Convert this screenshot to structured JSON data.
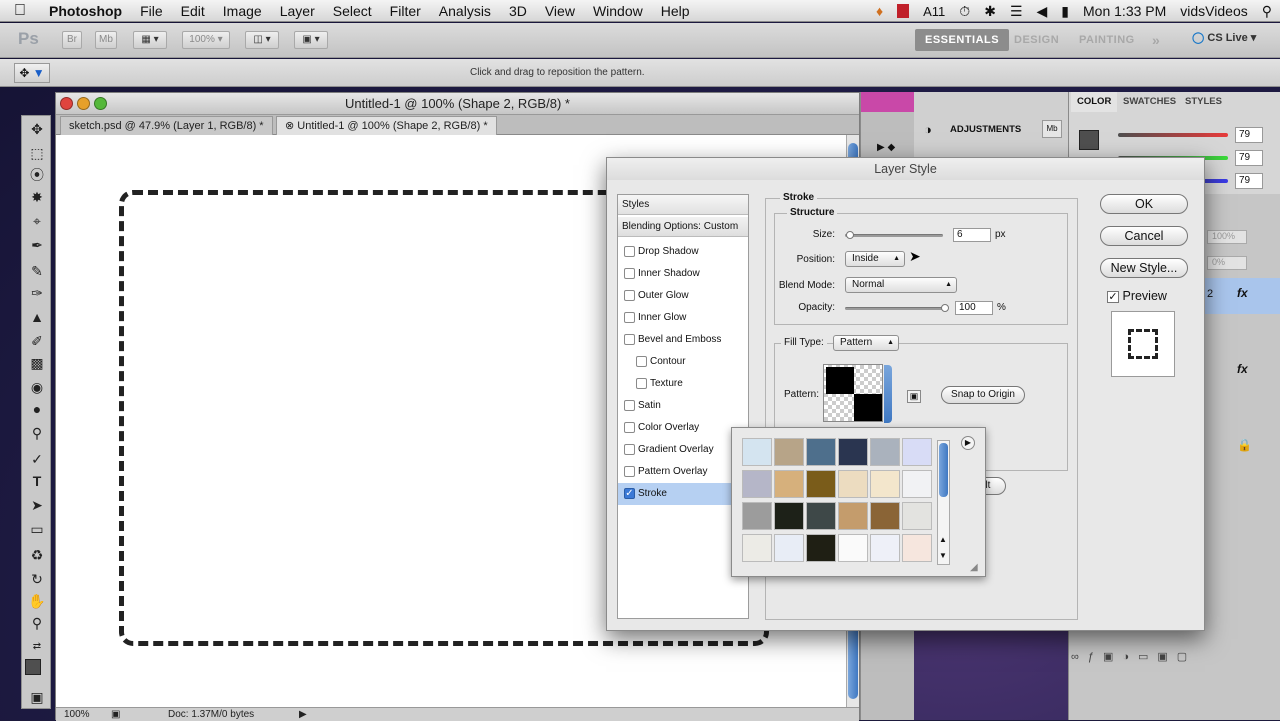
{
  "menubar": {
    "app": "Photoshop",
    "items": [
      "File",
      "Edit",
      "Image",
      "Layer",
      "Select",
      "Filter",
      "Analysis",
      "3D",
      "View",
      "Window",
      "Help"
    ],
    "status_num": "11",
    "clock": "Mon 1:33 PM",
    "user": "vidsVideos"
  },
  "appbar": {
    "logo": "Ps",
    "zoom": "100%",
    "workspaces": [
      "ESSENTIALS",
      "DESIGN",
      "PAINTING"
    ],
    "cslive": "CS Live"
  },
  "options": {
    "hint": "Click and drag to reposition the pattern."
  },
  "document": {
    "title": "Untitled-1 @ 100% (Shape 2, RGB/8) *",
    "tabs": [
      {
        "label": "sketch.psd @ 47.9% (Layer 1, RGB/8) *"
      },
      {
        "label": "Untitled-1 @ 100% (Shape 2, RGB/8) *"
      }
    ],
    "zoom": "100%",
    "doc_info": "Doc: 1.37M/0 bytes"
  },
  "panels": {
    "adjustments": "ADJUSTMENTS",
    "color_tabs": [
      "COLOR",
      "SWATCHES",
      "STYLES"
    ],
    "rgb": {
      "r": "79",
      "g": "79",
      "b": "79"
    },
    "layers_opacity": "100%",
    "layers_fill": "0%",
    "layer_name": "2"
  },
  "dialog": {
    "title": "Layer Style",
    "styles_header": "Styles",
    "blending": "Blending Options: Custom",
    "effects": [
      {
        "label": "Drop Shadow",
        "checked": false,
        "sub": false
      },
      {
        "label": "Inner Shadow",
        "checked": false,
        "sub": false
      },
      {
        "label": "Outer Glow",
        "checked": false,
        "sub": false
      },
      {
        "label": "Inner Glow",
        "checked": false,
        "sub": false
      },
      {
        "label": "Bevel and Emboss",
        "checked": false,
        "sub": false
      },
      {
        "label": "Contour",
        "checked": false,
        "sub": true
      },
      {
        "label": "Texture",
        "checked": false,
        "sub": true
      },
      {
        "label": "Satin",
        "checked": false,
        "sub": false
      },
      {
        "label": "Color Overlay",
        "checked": false,
        "sub": false
      },
      {
        "label": "Gradient Overlay",
        "checked": false,
        "sub": false
      },
      {
        "label": "Pattern Overlay",
        "checked": false,
        "sub": false
      },
      {
        "label": "Stroke",
        "checked": true,
        "sub": false
      }
    ],
    "stroke": {
      "group": "Stroke",
      "structure": "Structure",
      "size_label": "Size:",
      "size": "6",
      "size_unit": "px",
      "size_fraction": 0.05,
      "position_label": "Position:",
      "position": "Inside",
      "blend_label": "Blend Mode:",
      "blend": "Normal",
      "opacity_label": "Opacity:",
      "opacity": "100",
      "opacity_unit": "%",
      "opacity_fraction": 1.0,
      "filltype_label": "Fill Type:",
      "filltype": "Pattern",
      "pattern_label": "Pattern:",
      "snap": "Snap to Origin",
      "default_partial": "fault"
    },
    "buttons": {
      "ok": "OK",
      "cancel": "Cancel",
      "new_style": "New Style...",
      "preview": "Preview"
    }
  },
  "pattern_picker": {
    "swatches": [
      "#d4e4f0",
      "#b7a488",
      "#4e6f8c",
      "#2a3550",
      "#aab2bd",
      "#d8dcf6",
      "#b5b6c8",
      "#d6b07c",
      "#7a5c1a",
      "#ecdcc0",
      "#f3e6cc",
      "#f1f2f4",
      "#9c9c9c",
      "#1d2118",
      "#3e4848",
      "#c49c6c",
      "#8a6436",
      "#e3e3e0",
      "#ecebe6",
      "#e8edf6",
      "#1f1f14",
      "#fafafa",
      "#eef0f8",
      "#f6e6de"
    ]
  }
}
